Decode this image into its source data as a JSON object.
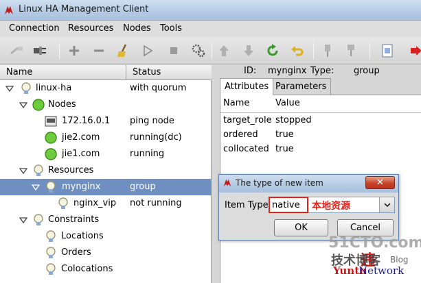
{
  "window": {
    "title": "Linux HA Management Client"
  },
  "menubar": [
    "Connection",
    "Resources",
    "Nodes",
    "Tools"
  ],
  "toolbar": {
    "icons": [
      "plug-disconnect-icon",
      "plug-connect-icon",
      "add-icon",
      "remove-icon",
      "broom-icon",
      "play-icon",
      "stop-icon",
      "gears-icon",
      "arrow-up-icon",
      "arrow-down-icon",
      "refresh-icon",
      "undo-icon",
      "pin-icon",
      "pin-down-icon",
      "document-icon",
      "exit-icon"
    ]
  },
  "tree": {
    "columns": {
      "name": "Name",
      "status": "Status"
    },
    "rows": [
      {
        "label": "linux-ha",
        "status": "with quorum",
        "icon": "bulb-icon"
      },
      {
        "label": "Nodes",
        "status": "",
        "icon": "green-circle-icon"
      },
      {
        "label": "172.16.0.1",
        "status": "ping node",
        "icon": "ping-node-icon"
      },
      {
        "label": "jie2.com",
        "status": "running(dc)",
        "icon": "green-circle-icon"
      },
      {
        "label": "jie1.com",
        "status": "running",
        "icon": "green-circle-icon"
      },
      {
        "label": "Resources",
        "status": "",
        "icon": "bulb-icon"
      },
      {
        "label": "mynginx",
        "status": "group",
        "icon": "bulb-icon"
      },
      {
        "label": "nginx_vip",
        "status": "not running",
        "icon": "bulb-icon"
      },
      {
        "label": "Constraints",
        "status": "",
        "icon": "bulb-icon"
      },
      {
        "label": "Locations",
        "status": "",
        "icon": "bulb-icon"
      },
      {
        "label": "Orders",
        "status": "",
        "icon": "bulb-icon"
      },
      {
        "label": "Colocations",
        "status": "",
        "icon": "bulb-icon"
      }
    ]
  },
  "details": {
    "id_label": "ID:",
    "id_value": "mynginx",
    "type_label": "Type:",
    "type_value": "group",
    "tabs": [
      "Attributes",
      "Parameters"
    ],
    "attr_columns": {
      "name": "Name",
      "value": "Value"
    },
    "attributes": [
      {
        "name": "target_role",
        "value": "stopped"
      },
      {
        "name": "ordered",
        "value": "true"
      },
      {
        "name": "collocated",
        "value": "true"
      }
    ]
  },
  "dialog": {
    "title": "The type of new item",
    "close_label": "✕",
    "item_type_label": "Item Type",
    "item_type_value": "native",
    "annotation": "本地资源",
    "ok_label": "OK",
    "cancel_label": "Cancel"
  },
  "watermark": {
    "site": "51CTO.com",
    "line2": "技术博客",
    "line3_red": "Yuntu",
    "line3_blue": "Network",
    "blog": "Blog",
    "mark": "违"
  },
  "colors": {
    "selection": "#6f8fc0",
    "annotation": "#e0241c",
    "title_bar": "#b8cde6"
  }
}
